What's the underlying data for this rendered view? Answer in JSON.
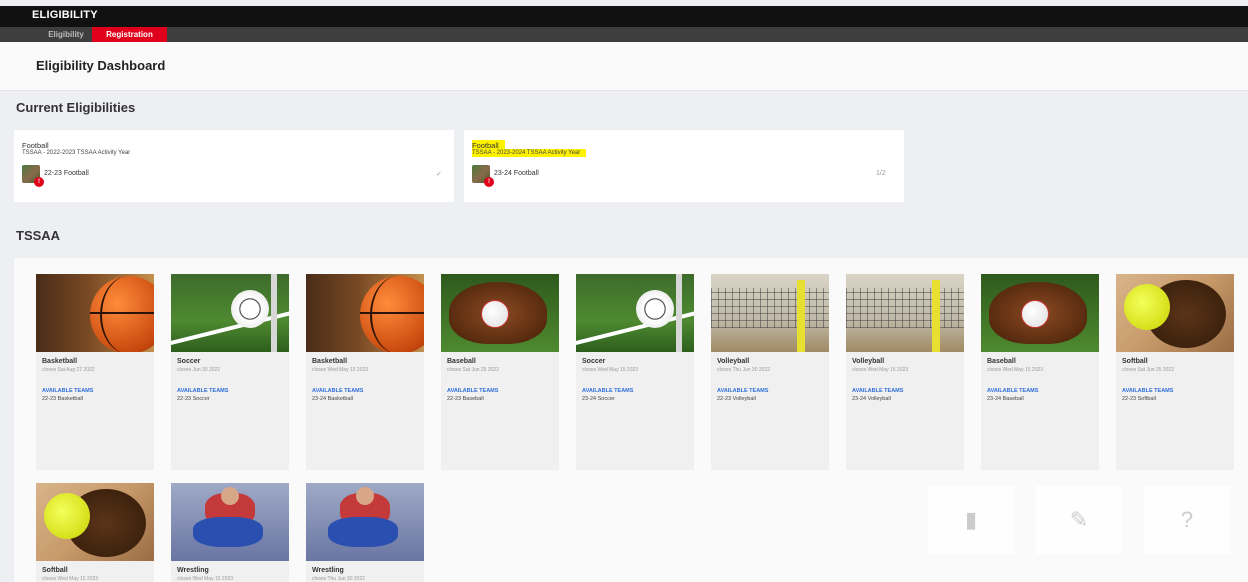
{
  "app": {
    "title": "ELIGIBILITY"
  },
  "tabs": [
    {
      "label": "Eligibility"
    },
    {
      "label": "Registration"
    }
  ],
  "dashboard": {
    "title": "Eligibility Dashboard"
  },
  "current": {
    "title": "Current Eligibilities",
    "cards": [
      {
        "sport": "Football",
        "year": "TSSAA - 2022-2023 TSSAA Activity Year",
        "registration": "22-23 Football",
        "status": "✓",
        "highlighted": false
      },
      {
        "sport": "Football",
        "year": "TSSAA - 2023-2024 TSSAA Activity Year",
        "registration": "23-24 Football",
        "status": "1/2",
        "highlighted": true
      }
    ]
  },
  "tssaa": {
    "title": "TSSAA",
    "sports": [
      {
        "name": "Basketball",
        "desc": "closes Sat Aug 27 2022",
        "avail": "AVAILABLE TEAMS",
        "season": "22-23 Basketball",
        "image": "basketball"
      },
      {
        "name": "Soccer",
        "desc": "closes Jun 30 2022",
        "avail": "AVAILABLE TEAMS",
        "season": "22-23 Soccer",
        "image": "soccer"
      },
      {
        "name": "Basketball",
        "desc": "closes Wed May 15 2023",
        "avail": "AVAILABLE TEAMS",
        "season": "23-24 Basketball",
        "image": "basketball"
      },
      {
        "name": "Baseball",
        "desc": "closes Sat Jun 25 2022",
        "avail": "AVAILABLE TEAMS",
        "season": "22-23 Baseball",
        "image": "baseball"
      },
      {
        "name": "Soccer",
        "desc": "closes Wed May 15 2023",
        "avail": "AVAILABLE TEAMS",
        "season": "23-24 Soccer",
        "image": "soccer"
      },
      {
        "name": "Volleyball",
        "desc": "closes Thu Jun 30 2022",
        "avail": "AVAILABLE TEAMS",
        "season": "22-23 Volleyball",
        "image": "volleyball"
      },
      {
        "name": "Volleyball",
        "desc": "closes Wed May 15 2023",
        "avail": "AVAILABLE TEAMS",
        "season": "23-24 Volleyball",
        "image": "volleyball"
      },
      {
        "name": "Baseball",
        "desc": "closes Wed May 15 2023",
        "avail": "AVAILABLE TEAMS",
        "season": "23-24 Baseball",
        "image": "baseball"
      },
      {
        "name": "Softball",
        "desc": "closes Sat Jun 25 2022",
        "avail": "AVAILABLE TEAMS",
        "season": "22-23 Softball",
        "image": "softball"
      },
      {
        "name": "Softball",
        "desc": "closes Wed May 15 2023",
        "image": "softball"
      },
      {
        "name": "Wrestling",
        "desc": "closes Wed May 15 2023",
        "image": "wrestling"
      },
      {
        "name": "Wrestling",
        "desc": "closes Thu Jun 30 2022",
        "image": "wrestling"
      }
    ]
  },
  "fab_icons": [
    "document-icon",
    "edit-icon",
    "help-icon"
  ],
  "colors": {
    "accent": "#e0001b",
    "link": "#2f6fd8",
    "highlight": "#fff200"
  }
}
